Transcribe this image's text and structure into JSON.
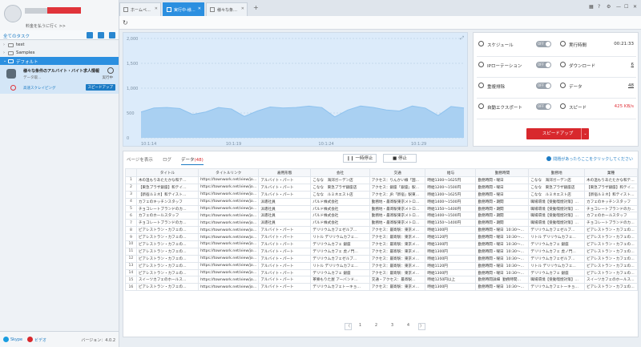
{
  "sidebar": {
    "plan_text": "料金を払うに行く >>",
    "tasks_label": "全てのタスク",
    "tree": [
      {
        "label": "test",
        "chev": "›"
      },
      {
        "label": "Samples",
        "chev": "›"
      },
      {
        "label": "デフォルト",
        "chev": "⌄"
      }
    ],
    "task": {
      "title": "様々な条件のアルバイト・バイト求人情報",
      "sub": "データ取…",
      "status": "実行中",
      "speed_label": "高速スクレイピング",
      "speed_button": "スピードアップ"
    },
    "footer": {
      "skype": "Skype",
      "video": "ビデオ",
      "version": "バージョン：4.0.2"
    }
  },
  "tabs": [
    {
      "label": "ホームペ…",
      "close": "✕"
    },
    {
      "label": "実行中-様…",
      "close": "✕"
    },
    {
      "label": "様々な条…",
      "close": "✕"
    }
  ],
  "chart_data": {
    "type": "area",
    "x_ticks": [
      "10:1:14",
      "10:1:19",
      "10:1:24",
      "10:1:29"
    ],
    "y_ticks": [
      0,
      500,
      1000,
      1500,
      2000
    ],
    "ylim": [
      0,
      2000
    ],
    "fill_color": "#a9d0f2",
    "line_color": "#8ec2ee",
    "x": [
      0,
      0.04,
      0.08,
      0.12,
      0.16,
      0.2,
      0.24,
      0.28,
      0.32,
      0.36,
      0.4,
      0.44,
      0.48,
      0.52,
      0.56,
      0.6,
      0.64,
      0.68,
      0.72,
      0.76,
      0.8,
      0.84,
      0.88,
      0.92,
      0.96,
      1.0
    ],
    "values": [
      520,
      600,
      610,
      590,
      470,
      520,
      610,
      580,
      430,
      540,
      620,
      600,
      610,
      640,
      610,
      420,
      560,
      640,
      610,
      560,
      540,
      640,
      600,
      450,
      630,
      600
    ]
  },
  "stats": {
    "schedule": {
      "label": "スケジュール",
      "toggle": "OFF"
    },
    "ip_rotation": {
      "label": "IPローテーション",
      "toggle": "OFF"
    },
    "dedupe": {
      "label": "重複排除",
      "toggle": "OFF"
    },
    "auto_export": {
      "label": "自動エクスポート",
      "toggle": "OFF"
    },
    "run_time": {
      "label": "実行時間",
      "value": "00:21:33"
    },
    "download": {
      "label": "ダウンロード",
      "value": "6"
    },
    "data": {
      "label": "データ",
      "value": "48"
    },
    "speed": {
      "label": "スピード",
      "value": "425 KB/s"
    },
    "speedup_button": "スピードアップ",
    "speedup_arrow": "⌄"
  },
  "data_area": {
    "subtab_page": "ページを表示",
    "subtab_log": "ログ",
    "subtab_data": "データ",
    "data_count": "(48)",
    "pause": "一時停止",
    "stop": "停止",
    "help": "問題があったらここをクリックしてください"
  },
  "table": {
    "headers": [
      "",
      "タイトル",
      "タイトルリンク",
      "雇用形態",
      "会社",
      "交通",
      "給与",
      "勤務時間",
      "勤務地",
      "業種"
    ],
    "rows": [
      [
        "1",
        "木の温もりあたたかな和テ…",
        "https://townwork.net/view/jo…",
        "アルバイト・パート",
        "こなな　海郊ガーデン店",
        "アクセス：りんかい線「国…",
        "時給1300～1625円",
        "勤務時間・曜日",
        "こなな　海郊ガーデン店",
        "木の温もりあたたかな和テ…"
      ],
      [
        "2",
        "【東急プラザ銀座】和テイ…",
        "https://townwork.net/view/jo…",
        "アルバイト・パート",
        "こなな　東急プラザ銀座店",
        "アクセス：銀座「銀座」駅…",
        "時給1200～1500円",
        "勤務時間・曜日",
        "こなな　東急プラザ銀座店",
        "【東急プラザ銀座】和テイ…"
      ],
      [
        "3",
        "【新宿ルミネ】和テイスト…",
        "https://townwork.net/view/jo…",
        "アルバイト・パート",
        "こなな　ルミネエスト店",
        "アクセス：JR「新宿」駅東…",
        "時給1300～1625円",
        "勤務時間・曜日",
        "こなな　ルミネエスト店",
        "【新宿ルミネ】和テイスト…"
      ],
      [
        "4",
        "カフェのキッチンスタッフ",
        "https://townwork.net/view/jo…",
        "派遣社員",
        "パルド株式会社",
        "勤務地・最寄駅東京メトロ…",
        "時給1400～1500円",
        "勤務時間・期間",
        "職場環境【受動喫煙対策】…",
        "カフェのキッチンスタッフ"
      ],
      [
        "5",
        "チョコレートブランドのカ…",
        "https://townwork.net/view/jo…",
        "派遣社員",
        "パルド株式会社",
        "勤務地・最寄駅東京メトロ…",
        "時給1350～1400円",
        "勤務時間・期間",
        "職場環境【受動喫煙対策】…",
        "チョコレートブランドのカ…"
      ],
      [
        "6",
        "カフェのホールスタッフ",
        "https://townwork.net/view/jo…",
        "派遣社員",
        "パルド株式会社",
        "勤務地・最寄駅東京メトロ…",
        "時給1400～1500円",
        "勤務時間・期間",
        "職場環境【受動喫煙対策】…",
        "カフェのホールスタッフ"
      ],
      [
        "7",
        "チョコレートブランドのカ…",
        "https://townwork.net/view/jo…",
        "派遣社員",
        "パルド株式会社",
        "勤務地・最寄駅東京メトロ…",
        "時給1350～1400円",
        "勤務時間・期間",
        "職場環境【受動喫煙対策】…",
        "チョコレートブランドのカ…"
      ],
      [
        "8",
        "ビアレストラン・カフェの…",
        "https://townwork.net/view/jo…",
        "アルバイト・パート",
        "デリリウムカフェゼルブ…",
        "アクセス：最寄駅：東京メ…",
        "時給1300円",
        "勤務時間・曜日",
        "10:30～…",
        "デリリウムカフェゼルブ…",
        "ビアレストラン・カフェの…"
      ],
      [
        "9",
        "ビアレストラン・カフェの…",
        "https://townwork.net/view/jo…",
        "アルバイト・パート",
        "リトル デリリウムカフェ…",
        "アクセス：最寄駅：東京メ…",
        "時給1120円",
        "勤務時間・曜日",
        "10:30～…",
        "リトル デリリウムカフェ…",
        "ビアレストラン・カフェの…"
      ],
      [
        "10",
        "ビアレストラン・カフェの…",
        "https://townwork.net/view/jo…",
        "アルバイト・パート",
        "デリリウムカフェ 銀座",
        "アクセス：最寄駅：東京メ…",
        "時給1300円",
        "勤務時間・曜日",
        "10:30～…",
        "デリリウムカフェ 銀座",
        "ビアレストラン・カフェの…"
      ],
      [
        "11",
        "ビアレストラン・カフェの…",
        "https://townwork.net/view/jo…",
        "アルバイト・パート",
        "デリリウムカフェ 虎ノ門…",
        "アクセス：最寄駅：東京メ…",
        "時給1300円",
        "勤務時間・曜日",
        "10:30～…",
        "デリリウムカフェ 虎ノ門…",
        "ビアレストラン・カフェの…"
      ],
      [
        "12",
        "ビアレストラン・カフェの…",
        "https://townwork.net/view/jo…",
        "アルバイト・パート",
        "デリリウムカフェゼルブ…",
        "アクセス：最寄駅：東京メ…",
        "時給1300円",
        "勤務時間・曜日",
        "10:30～…",
        "デリリウムカフェゼルブ…",
        "ビアレストラン・カフェの…"
      ],
      [
        "13",
        "ビアレストラン・カフェの…",
        "https://townwork.net/view/jo…",
        "アルバイト・パート",
        "リトル デリリウムカフェ…",
        "アクセス：最寄駅：東京メ…",
        "時給1120円",
        "勤務時間・曜日",
        "10:30～…",
        "リトル デリリウムカフェ…",
        "ビアレストラン・カフェの…"
      ],
      [
        "14",
        "ビアレストラン・カフェの…",
        "https://townwork.net/view/jo…",
        "アルバイト・パート",
        "デリリウムカフェ 銀座",
        "アクセス：最寄駅：東京メ…",
        "時給1300円",
        "勤務時間・曜日",
        "10:30～…",
        "デリリウムカフェ 銀座",
        "ビアレストラン・カフェの…"
      ],
      [
        "15",
        "スイーツカフェのホールス…",
        "https://townwork.net/view/jo…",
        "アルバイト・パート",
        "茶寮もりた屋 アーバンド…",
        "交通・アクセス：最寄駅…",
        "時給1250円以上",
        "勤務時間詳細",
        "勤務時間…",
        "職場環境【受動喫煙対策】…",
        "スイーツカフェのホールス…"
      ],
      [
        "16",
        "ビアレストラン・カフェの…",
        "https://townwork.net/view/jo…",
        "アルバイト・パート",
        "デリリウムカフェトーキョ…",
        "アクセス：最寄駅：東京メ…",
        "時給1300円",
        "勤務時間・曜日",
        "10:30～…",
        "デリリウムカフェトーキョ…",
        "ビアレストラン・カフェの…"
      ]
    ]
  },
  "pager": {
    "prev": "〈",
    "pages": [
      "1",
      "2",
      "3",
      "4"
    ],
    "next": "〉"
  }
}
